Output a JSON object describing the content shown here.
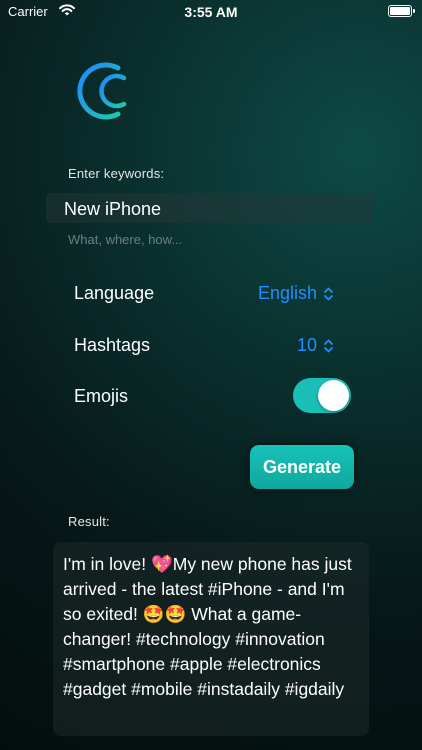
{
  "status_bar": {
    "carrier": "Carrier",
    "time": "3:55 AM"
  },
  "keywords": {
    "label": "Enter keywords:",
    "value": "New iPhone",
    "hint": "What, where, how..."
  },
  "settings": {
    "language_label": "Language",
    "language_value": "English",
    "hashtags_label": "Hashtags",
    "hashtags_value": "10",
    "emojis_label": "Emojis",
    "emojis_enabled": true
  },
  "generate_label": "Generate",
  "result": {
    "label": "Result:",
    "text": "I'm in love! 💖My new phone has just arrived - the latest #iPhone - and I'm so exited! 🤩🤩 What a game-changer! #technology #innovation #smartphone #apple #electronics #gadget #mobile #instadaily #igdaily"
  },
  "colors": {
    "accent": "#1abfb5",
    "picker_blue": "#1e90ff",
    "logo_gradient_start": "#1e88ff",
    "logo_gradient_end": "#1ec9a8"
  }
}
